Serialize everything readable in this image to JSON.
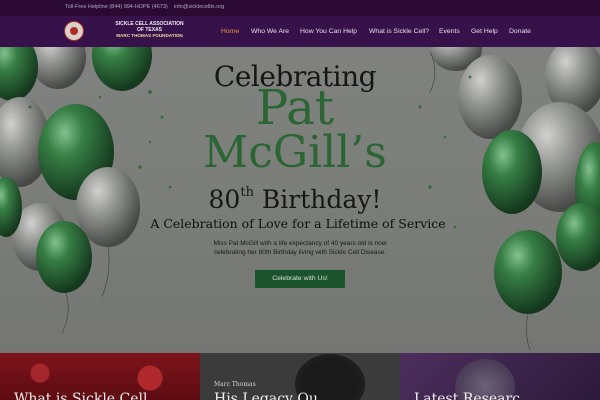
{
  "topbar": {
    "helpline": "Toll-Free Helpline (844) 994-HOPE (4673)",
    "email": "info@sicklecelltx.org"
  },
  "logo": {
    "line1": "SICKLE CELL ASSOCIATION",
    "line2": "OF TEXAS",
    "line3": "MARC THOMAS FOUNDATION"
  },
  "nav": {
    "items": [
      "Home",
      "Who We Are",
      "How You Can Help",
      "What is Sickle Cell?",
      "Events",
      "Get Help",
      "Donate"
    ],
    "active": "Home"
  },
  "hero": {
    "celebrating": "Celebrating",
    "name_first": "Pat",
    "name_last": "McGill’s",
    "age_number": "80",
    "age_suffix": "th",
    "birthday": "Birthday!",
    "subtitle": "A Celebration of Love for a Lifetime of Service",
    "description": "Miss Pat McGill with a life expectancy of 40 years old is now celebrating her 80th Birthday living with Sickle Cell Disease.",
    "cta": "Celebrate with Us!",
    "balloon_colors": {
      "green": "#2e6e38",
      "silver": "#9a9c98"
    }
  },
  "cards": [
    {
      "title": "What is Sickle Cell",
      "byline": ""
    },
    {
      "title": "His Legacy Ou",
      "byline": "Marc Thomas"
    },
    {
      "title": "Latest Researc",
      "byline": ""
    }
  ]
}
